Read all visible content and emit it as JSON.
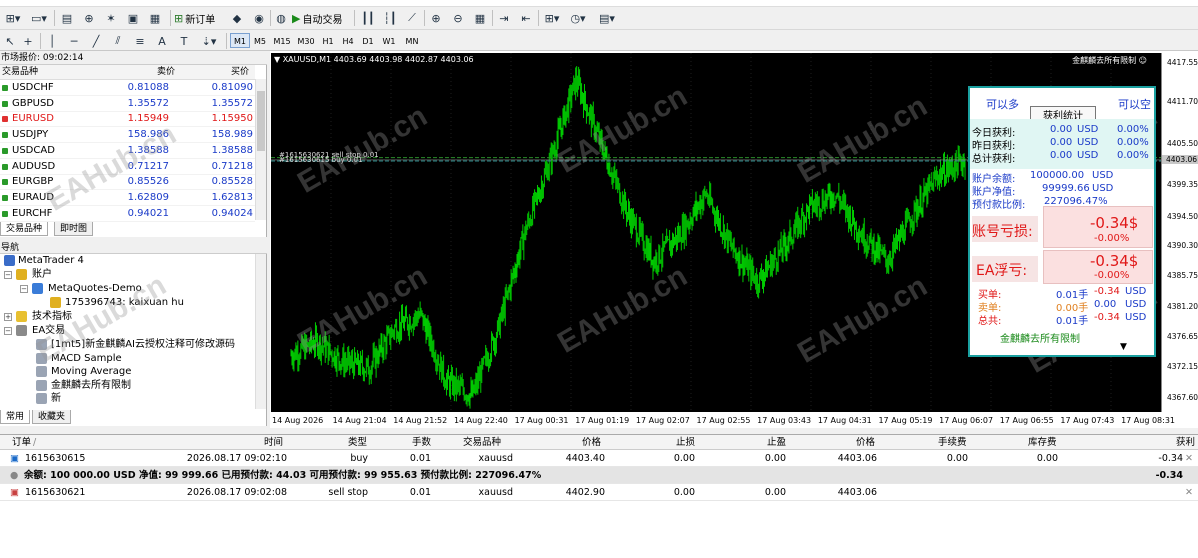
{
  "toolbar": {
    "new_order": "新订单",
    "auto_trade": "自动交易",
    "timeframes": [
      "M1",
      "M5",
      "M15",
      "M30",
      "H1",
      "H4",
      "D1",
      "W1",
      "MN"
    ],
    "active_timeframe": "M1"
  },
  "market_watch": {
    "title": "市场报价: 09:02:14",
    "col_symbol": "交易品种",
    "col_bid": "卖价",
    "col_ask": "买价",
    "rows": [
      {
        "symbol": "USDCHF",
        "bid": "0.81088",
        "ask": "0.81090",
        "dir": "up"
      },
      {
        "symbol": "GBPUSD",
        "bid": "1.35572",
        "ask": "1.35572",
        "dir": "up"
      },
      {
        "symbol": "EURUSD",
        "bid": "1.15949",
        "ask": "1.15950",
        "dir": "down"
      },
      {
        "symbol": "USDJPY",
        "bid": "158.986",
        "ask": "158.989",
        "dir": "up"
      },
      {
        "symbol": "USDCAD",
        "bid": "1.38588",
        "ask": "1.38588",
        "dir": "up"
      },
      {
        "symbol": "AUDUSD",
        "bid": "0.71217",
        "ask": "0.71218",
        "dir": "up"
      },
      {
        "symbol": "EURGBP",
        "bid": "0.85526",
        "ask": "0.85528",
        "dir": "up"
      },
      {
        "symbol": "EURAUD",
        "bid": "1.62809",
        "ask": "1.62813",
        "dir": "up"
      },
      {
        "symbol": "EURCHF",
        "bid": "0.94021",
        "ask": "0.94024",
        "dir": "up"
      }
    ],
    "tabs": [
      "交易品种",
      "即时图"
    ]
  },
  "navigator": {
    "title": "导航",
    "root": "MetaTrader 4",
    "accounts": "账户",
    "server": "MetaQuotes-Demo",
    "account": "175396743: kaixuan hu",
    "indicators": "技术指标",
    "ea": "EA交易",
    "ea_items": [
      "[1mt5]新金麒麟AI云授权注释可修改源码",
      "MACD Sample",
      "Moving Average",
      "金麒麟去所有限制",
      "新"
    ],
    "tabs": [
      "常用",
      "收藏夹"
    ]
  },
  "chart": {
    "title": "XAUUSD,M1  4403.69 4403.98 4402.87 4403.06",
    "ea_name": "金麒麟去所有限制",
    "order_line_label": "#1615630615 buy 0.01",
    "order_line_label2": "#1615630621 sell stop 0.01",
    "current_price": "4403.06",
    "y_ticks": [
      "4417.55",
      "4411.70",
      "4405.50",
      "4399.35",
      "4394.50",
      "4390.30",
      "4385.75",
      "4381.20",
      "4376.65",
      "4372.15",
      "4367.60"
    ],
    "x_ticks": [
      "14 Aug 2026",
      "14 Aug 21:04",
      "14 Aug 21:52",
      "14 Aug 22:40",
      "17 Aug 00:31",
      "17 Aug 01:19",
      "17 Aug 02:07",
      "17 Aug 02:55",
      "17 Aug 03:43",
      "17 Aug 04:31",
      "17 Aug 05:19",
      "17 Aug 06:07",
      "17 Aug 06:55",
      "17 Aug 07:43",
      "17 Aug 08:31"
    ],
    "watermark": "EAHub.cn",
    "colors": {
      "candle": "#00cc00",
      "background": "#000000",
      "panel_border": "#1aa0a0"
    }
  },
  "ea_panel": {
    "can_long": "可以多",
    "title": "获利统计",
    "can_short": "可以空",
    "today_label": "今日获利:",
    "today_val": "0.00",
    "today_cur": "USD",
    "today_pct": "0.00%",
    "yesterday_label": "昨日获利:",
    "yesterday_val": "0.00",
    "yesterday_cur": "USD",
    "yesterday_pct": "0.00%",
    "total_label": "总计获利:",
    "total_val": "0.00",
    "total_cur": "USD",
    "total_pct": "0.00%",
    "balance_label": "账户余额:",
    "balance_val": "100000.00",
    "balance_cur": "USD",
    "equity_label": "账户净值:",
    "equity_val": "99999.66",
    "equity_cur": "USD",
    "margin_label": "预付款比例:",
    "margin_val": "227096.47%",
    "acct_loss_label": "账号亏损:",
    "acct_loss_val": "-0.34$",
    "acct_loss_pct": "-0.00%",
    "ea_float_label": "EA浮亏:",
    "ea_float_val": "-0.34$",
    "ea_float_pct": "-0.00%",
    "buy_label": "买单:",
    "buy_lots": "0.01手",
    "buy_profit": "-0.34",
    "buy_cur": "USD",
    "sell_label": "卖单:",
    "sell_lots": "0.00手",
    "sell_profit": "0.00",
    "sell_cur": "USD",
    "all_label": "总共:",
    "all_lots": "0.01手",
    "all_profit": "-0.34",
    "all_cur": "USD",
    "footer": "金麒麟去所有限制",
    "arrow": "▼"
  },
  "orders": {
    "headers": {
      "order": "订单",
      "time": "时间",
      "type": "类型",
      "lots": "手数",
      "symbol": "交易品种",
      "price": "价格",
      "sl": "止损",
      "tp": "止盈",
      "cur_price": "价格",
      "commission": "手续费",
      "swap": "库存费",
      "profit": "获利"
    },
    "rows": [
      {
        "order": "1615630615",
        "time": "2026.08.17 09:02:10",
        "type": "buy",
        "lots": "0.01",
        "symbol": "xauusd",
        "price": "4403.40",
        "sl": "0.00",
        "tp": "0.00",
        "cur_price": "4403.06",
        "commission": "0.00",
        "swap": "0.00",
        "profit": "-0.34"
      },
      {
        "order": "1615630621",
        "time": "2026.08.17 09:02:08",
        "type": "sell stop",
        "lots": "0.01",
        "symbol": "xauusd",
        "price": "4402.90",
        "sl": "0.00",
        "tp": "0.00",
        "cur_price": "4403.06",
        "commission": "",
        "swap": "",
        "profit": ""
      }
    ],
    "balance_line": "余额: 100 000.00 USD  净值: 99 999.66  已用预付款: 44.03  可用预付款: 99 955.63  预付款比例: 227096.47%",
    "balance_profit": "-0.34"
  },
  "chart_data": {
    "type": "line",
    "x": [
      "14 Aug 2026",
      "14 Aug 21:04",
      "14 Aug 21:52",
      "14 Aug 22:40",
      "17 Aug 00:31",
      "17 Aug 01:19",
      "17 Aug 02:07",
      "17 Aug 02:55",
      "17 Aug 03:43",
      "17 Aug 04:31",
      "17 Aug 05:19",
      "17 Aug 06:07",
      "17 Aug 06:55",
      "17 Aug 07:43",
      "17 Aug 08:31"
    ],
    "series": [
      {
        "values": [
          4374,
          4376,
          4373,
          4372,
          4378,
          4380,
          4370,
          4368,
          4378,
          4392,
          4403,
          4415,
          4405,
          4395,
          4388,
          4392,
          4398,
          4390,
          4385,
          4390,
          4396,
          4398,
          4392,
          4388,
          4395,
          4401,
          4403
        ]
      }
    ],
    "ylim": [
      4365.5,
      4419.0
    ]
  }
}
